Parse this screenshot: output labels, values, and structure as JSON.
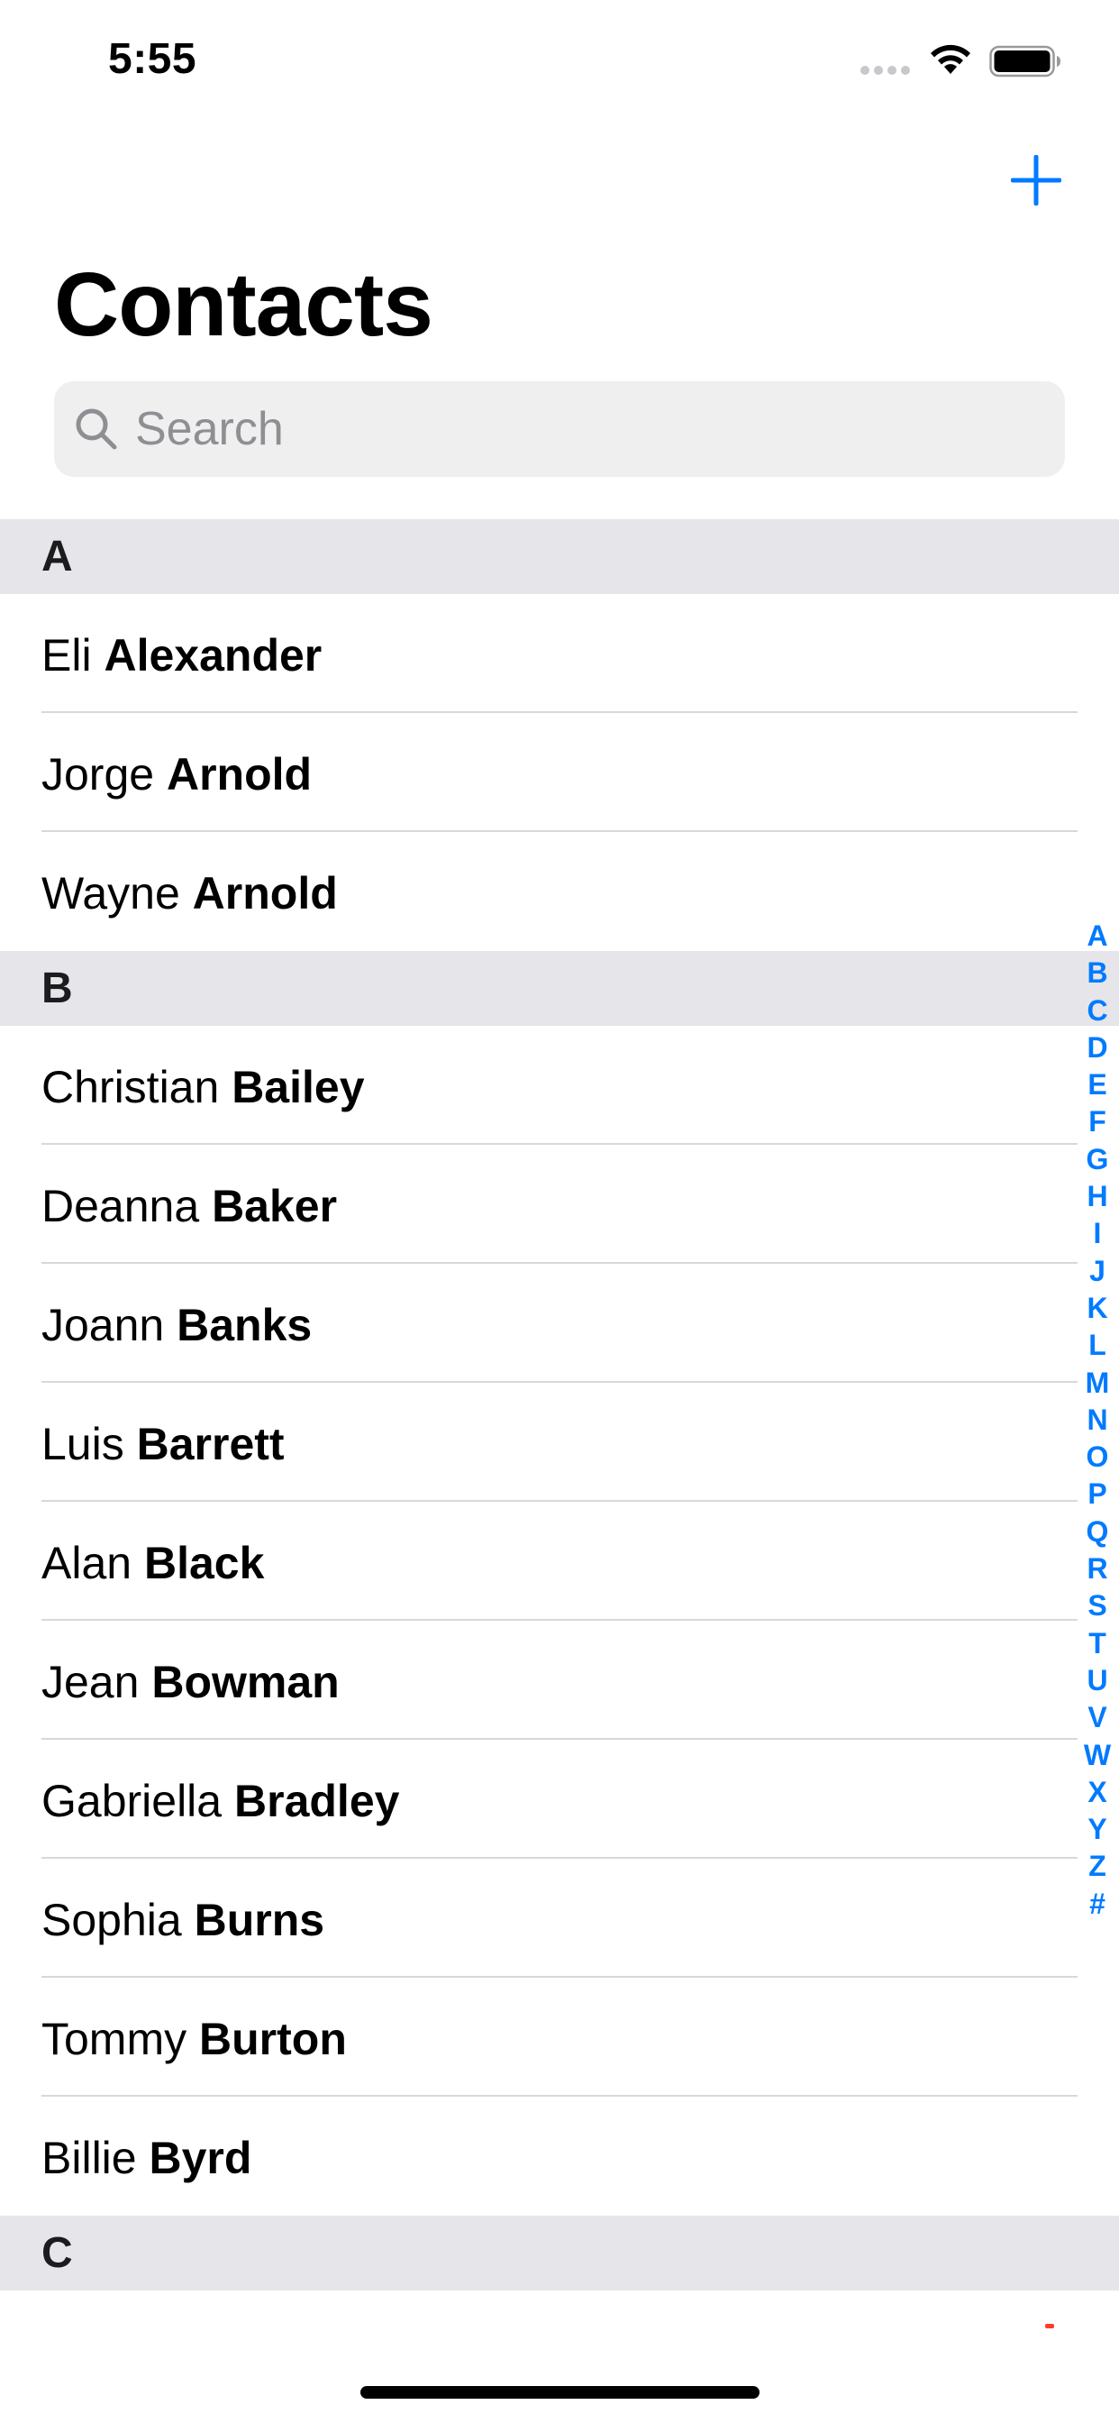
{
  "status_bar": {
    "time": "5:55"
  },
  "nav": {
    "title": "Contacts",
    "add_icon": "plus-icon"
  },
  "search": {
    "placeholder": "Search",
    "icon": "search-icon"
  },
  "sections": [
    {
      "letter": "A",
      "contacts": [
        {
          "first": "Eli",
          "last": "Alexander"
        },
        {
          "first": "Jorge",
          "last": "Arnold"
        },
        {
          "first": "Wayne",
          "last": "Arnold"
        }
      ]
    },
    {
      "letter": "B",
      "contacts": [
        {
          "first": "Christian",
          "last": "Bailey"
        },
        {
          "first": "Deanna",
          "last": "Baker"
        },
        {
          "first": "Joann",
          "last": "Banks"
        },
        {
          "first": "Luis",
          "last": "Barrett"
        },
        {
          "first": "Alan",
          "last": "Black"
        },
        {
          "first": "Jean",
          "last": "Bowman"
        },
        {
          "first": "Gabriella",
          "last": "Bradley"
        },
        {
          "first": "Sophia",
          "last": "Burns"
        },
        {
          "first": "Tommy",
          "last": "Burton"
        },
        {
          "first": "Billie",
          "last": "Byrd"
        }
      ]
    },
    {
      "letter": "C",
      "contacts": []
    }
  ],
  "index": [
    "A",
    "B",
    "C",
    "D",
    "E",
    "F",
    "G",
    "H",
    "I",
    "J",
    "K",
    "L",
    "M",
    "N",
    "O",
    "P",
    "Q",
    "R",
    "S",
    "T",
    "U",
    "V",
    "W",
    "X",
    "Y",
    "Z",
    "#"
  ],
  "colors": {
    "accent": "#007aff",
    "section_bg": "#e5e5ea",
    "search_bg": "#efeff0",
    "separator": "#d8d8dc"
  }
}
